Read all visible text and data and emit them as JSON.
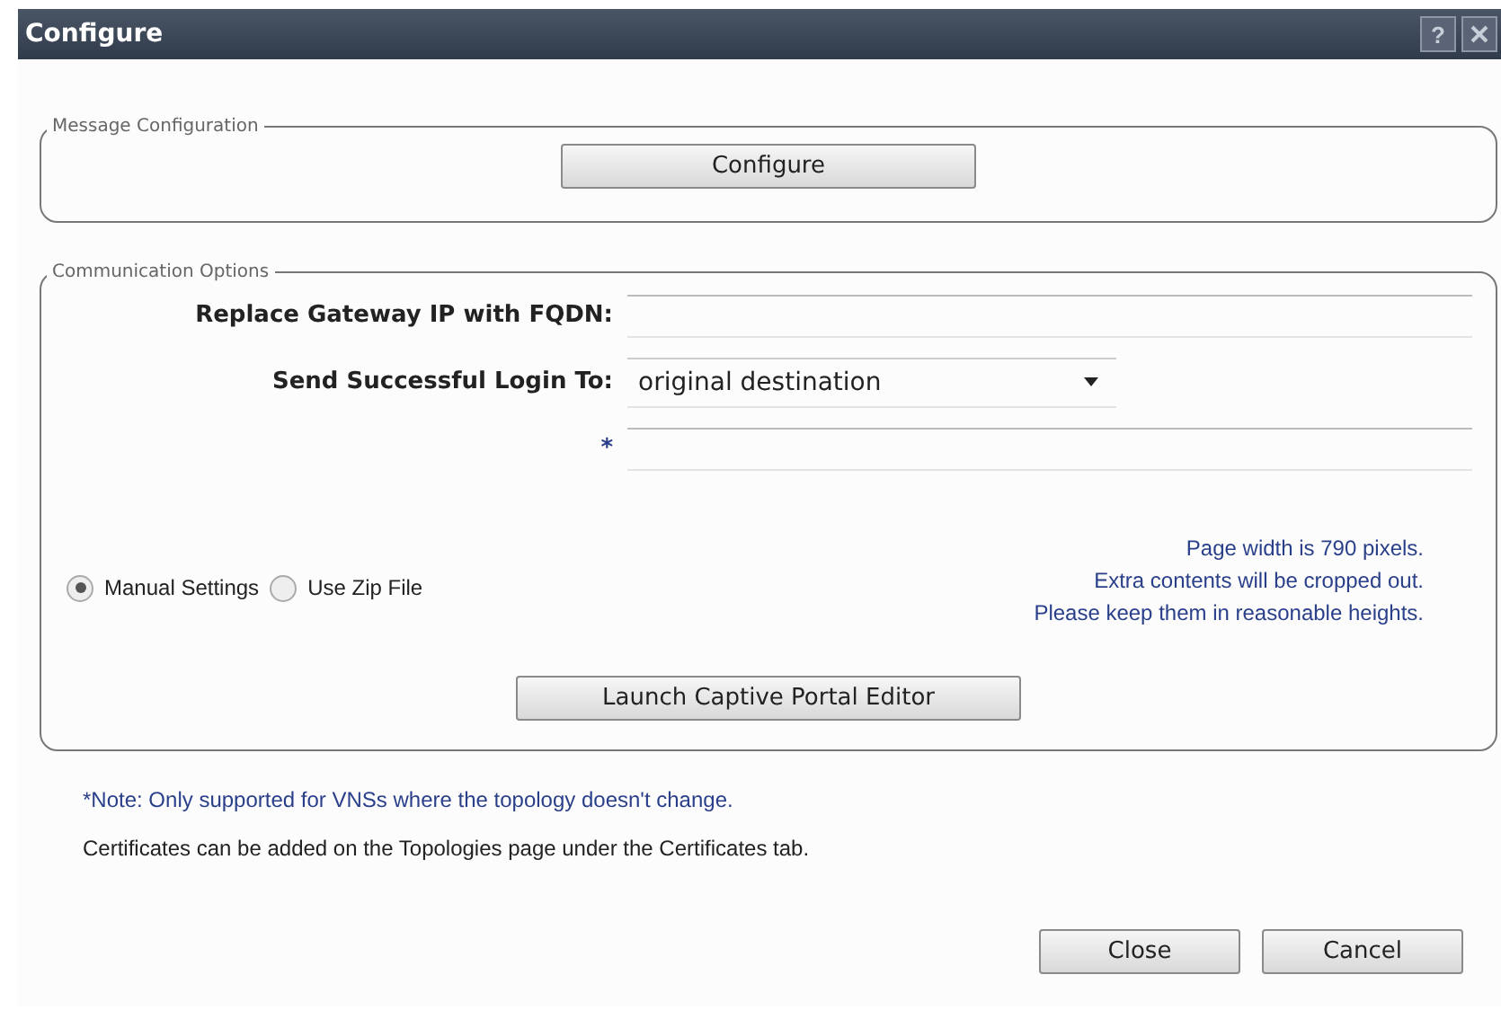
{
  "window": {
    "title": "Configure",
    "help_label": "?"
  },
  "message_configuration": {
    "legend": "Message Configuration",
    "button": "Configure"
  },
  "communication_options": {
    "legend": "Communication Options",
    "fields": [
      {
        "kind": "text",
        "label": "Replace Gateway IP with FQDN:"
      },
      {
        "kind": "select",
        "label": "Send Successful Login To:",
        "value": "original destination"
      },
      {
        "kind": "text",
        "label": "*"
      }
    ],
    "radios": [
      {
        "label": "Manual Settings",
        "selected": true
      },
      {
        "label": "Use Zip File",
        "selected": false
      }
    ],
    "hints": [
      "Page width is 790 pixels.",
      "Extra contents will be cropped out.",
      "Please keep them in reasonable heights."
    ],
    "button": "Launch Captive Portal Editor"
  },
  "note": "*Note: Only supported for VNSs where the topology doesn't change.",
  "certificates_text": "Certificates can be added on the Topologies page under the Certificates tab.",
  "buttons": [
    "Close",
    "Cancel"
  ]
}
